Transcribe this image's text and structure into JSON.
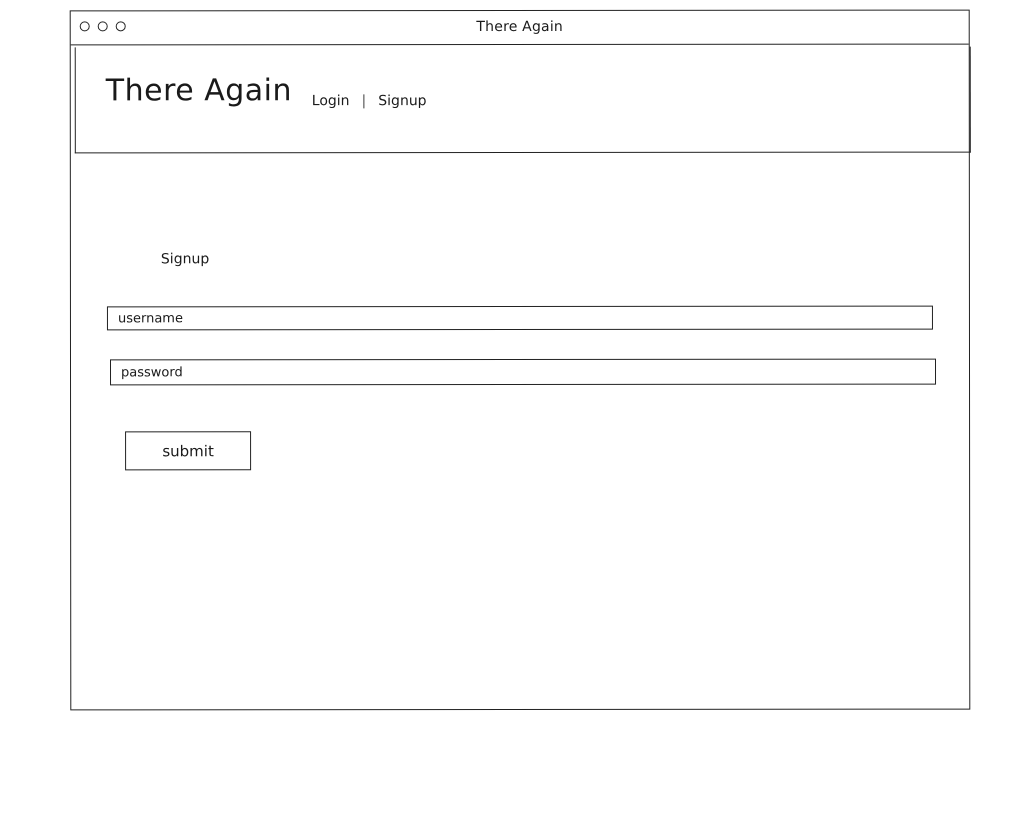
{
  "window": {
    "title": "There Again",
    "controls": [
      "circle",
      "circle",
      "circle"
    ]
  },
  "header": {
    "brand": "There Again",
    "nav": {
      "login": "Login",
      "separator": "|",
      "signup": "Signup"
    }
  },
  "form": {
    "title": "Signup",
    "username_placeholder": "username",
    "password_placeholder": "password",
    "submit_label": "submit"
  }
}
